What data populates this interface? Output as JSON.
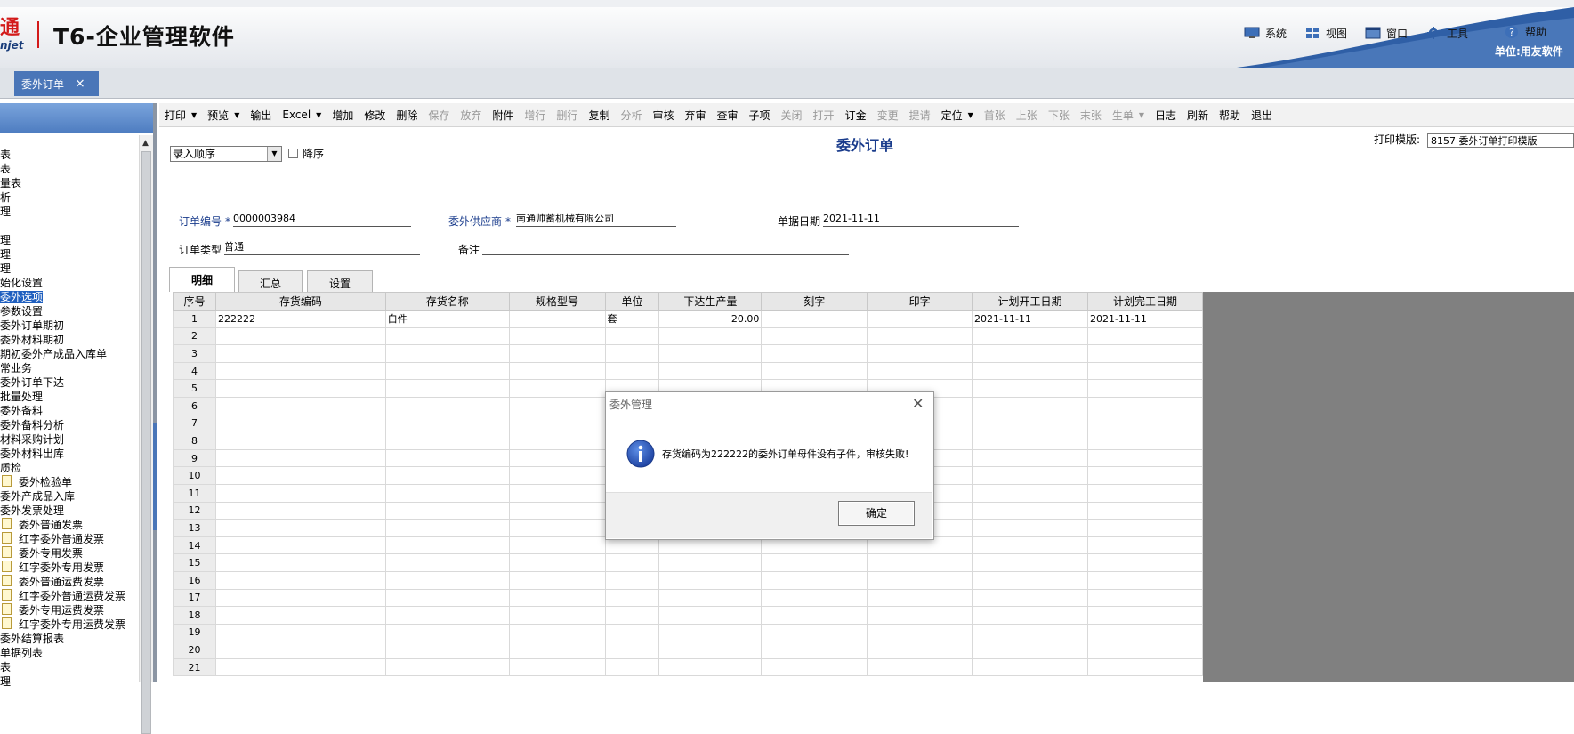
{
  "header": {
    "logo_main": "通",
    "logo_sub": "njet",
    "app_title": "T6-企业管理软件",
    "menu": [
      {
        "label": "系统",
        "icon": "monitor-icon"
      },
      {
        "label": "视图",
        "icon": "grid-icon"
      },
      {
        "label": "窗口",
        "icon": "window-icon"
      },
      {
        "label": "工具",
        "icon": "tools-icon"
      },
      {
        "label": "帮助",
        "icon": "help-icon"
      }
    ],
    "unit_label": "单位:用友软件"
  },
  "tabs": [
    {
      "label": "委外订单"
    }
  ],
  "sidebar": {
    "items": [
      {
        "label": "表"
      },
      {
        "label": "表"
      },
      {
        "label": "量表"
      },
      {
        "label": "析"
      },
      {
        "label": "理"
      },
      {
        "label": ""
      },
      {
        "label": "理"
      },
      {
        "label": "理"
      },
      {
        "label": "理"
      },
      {
        "label": "始化设置"
      },
      {
        "label": "委外选项",
        "selected": true
      },
      {
        "label": "参数设置"
      },
      {
        "label": "委外订单期初"
      },
      {
        "label": "委外材料期初"
      },
      {
        "label": "期初委外产成品入库单"
      },
      {
        "label": "常业务"
      },
      {
        "label": "委外订单下达"
      },
      {
        "label": "批量处理"
      },
      {
        "label": "委外备料"
      },
      {
        "label": "委外备料分析"
      },
      {
        "label": "材料采购计划"
      },
      {
        "label": "委外材料出库"
      },
      {
        "label": "质检"
      },
      {
        "label": "委外检验单",
        "folder": true
      },
      {
        "label": "委外产成品入库"
      },
      {
        "label": "委外发票处理"
      },
      {
        "label": "委外普通发票",
        "folder": true
      },
      {
        "label": "红字委外普通发票",
        "folder": true
      },
      {
        "label": "委外专用发票",
        "folder": true
      },
      {
        "label": "红字委外专用发票",
        "folder": true
      },
      {
        "label": "委外普通运费发票",
        "folder": true
      },
      {
        "label": "红字委外普通运费发票",
        "folder": true
      },
      {
        "label": "委外专用运费发票",
        "folder": true
      },
      {
        "label": "红字委外专用运费发票",
        "folder": true
      },
      {
        "label": "委外结算报表"
      },
      {
        "label": "单据列表"
      },
      {
        "label": "表"
      },
      {
        "label": "理"
      }
    ]
  },
  "toolbar": {
    "buttons": [
      {
        "label": "打印",
        "dropdown": true
      },
      {
        "label": "预览",
        "dropdown": true
      },
      {
        "label": "输出"
      },
      {
        "label": "Excel",
        "dropdown": true
      },
      {
        "label": "增加"
      },
      {
        "label": "修改"
      },
      {
        "label": "删除"
      },
      {
        "label": "保存",
        "disabled": true
      },
      {
        "label": "放弃",
        "disabled": true
      },
      {
        "label": "附件"
      },
      {
        "label": "增行",
        "disabled": true
      },
      {
        "label": "删行",
        "disabled": true
      },
      {
        "label": "复制"
      },
      {
        "label": "分析",
        "disabled": true
      },
      {
        "label": "审核"
      },
      {
        "label": "弃审"
      },
      {
        "label": "查审"
      },
      {
        "label": "子项"
      },
      {
        "label": "关闭",
        "disabled": true
      },
      {
        "label": "打开",
        "disabled": true
      },
      {
        "label": "订金"
      },
      {
        "label": "变更",
        "disabled": true
      },
      {
        "label": "提请",
        "disabled": true
      },
      {
        "label": "定位",
        "dropdown": true
      },
      {
        "label": "首张",
        "disabled": true
      },
      {
        "label": "上张",
        "disabled": true
      },
      {
        "label": "下张",
        "disabled": true
      },
      {
        "label": "末张",
        "disabled": true
      },
      {
        "label": "生单",
        "dropdown": true,
        "disabled": true
      },
      {
        "label": "日志"
      },
      {
        "label": "刷新"
      },
      {
        "label": "帮助"
      },
      {
        "label": "退出"
      }
    ]
  },
  "form": {
    "title": "委外订单",
    "print_template_label": "打印模版:",
    "print_template_value": "8157 委外订单打印模版",
    "sort_value": "录入顺序",
    "desc_label": "降序",
    "order_no_label": "订单编号",
    "order_no_value": "0000003984",
    "supplier_label": "委外供应商",
    "supplier_value": "南通帅蓄机械有限公司",
    "date_label": "单据日期",
    "date_value": "2021-11-11",
    "order_type_label": "订单类型",
    "order_type_value": "普通",
    "remark_label": "备注",
    "remark_value": "",
    "required_mark": "*"
  },
  "form_tabs": [
    {
      "label": "明细",
      "active": true
    },
    {
      "label": "汇总"
    },
    {
      "label": "设置"
    }
  ],
  "grid": {
    "columns": [
      "序号",
      "存货编码",
      "存货名称",
      "规格型号",
      "单位",
      "下达生产量",
      "刻字",
      "印字",
      "计划开工日期",
      "计划完工日期"
    ],
    "rows": [
      [
        "1",
        "222222",
        "白件",
        "",
        "套",
        "20.00",
        "",
        "",
        "2021-11-11",
        "2021-11-11"
      ],
      [
        "2",
        "",
        "",
        "",
        "",
        "",
        "",
        "",
        "",
        ""
      ],
      [
        "3",
        "",
        "",
        "",
        "",
        "",
        "",
        "",
        "",
        ""
      ],
      [
        "4",
        "",
        "",
        "",
        "",
        "",
        "",
        "",
        "",
        ""
      ],
      [
        "5",
        "",
        "",
        "",
        "",
        "",
        "",
        "",
        "",
        ""
      ],
      [
        "6",
        "",
        "",
        "",
        "",
        "",
        "",
        "",
        "",
        ""
      ],
      [
        "7",
        "",
        "",
        "",
        "",
        "",
        "",
        "",
        "",
        ""
      ],
      [
        "8",
        "",
        "",
        "",
        "",
        "",
        "",
        "",
        "",
        ""
      ],
      [
        "9",
        "",
        "",
        "",
        "",
        "",
        "",
        "",
        "",
        ""
      ],
      [
        "10",
        "",
        "",
        "",
        "",
        "",
        "",
        "",
        "",
        ""
      ],
      [
        "11",
        "",
        "",
        "",
        "",
        "",
        "",
        "",
        "",
        ""
      ],
      [
        "12",
        "",
        "",
        "",
        "",
        "",
        "",
        "",
        "",
        ""
      ],
      [
        "13",
        "",
        "",
        "",
        "",
        "",
        "",
        "",
        "",
        ""
      ],
      [
        "14",
        "",
        "",
        "",
        "",
        "",
        "",
        "",
        "",
        ""
      ],
      [
        "15",
        "",
        "",
        "",
        "",
        "",
        "",
        "",
        "",
        ""
      ],
      [
        "16",
        "",
        "",
        "",
        "",
        "",
        "",
        "",
        "",
        ""
      ],
      [
        "17",
        "",
        "",
        "",
        "",
        "",
        "",
        "",
        "",
        ""
      ],
      [
        "18",
        "",
        "",
        "",
        "",
        "",
        "",
        "",
        "",
        ""
      ],
      [
        "19",
        "",
        "",
        "",
        "",
        "",
        "",
        "",
        "",
        ""
      ],
      [
        "20",
        "",
        "",
        "",
        "",
        "",
        "",
        "",
        "",
        ""
      ],
      [
        "21",
        "",
        "",
        "",
        "",
        "",
        "",
        "",
        "",
        ""
      ]
    ]
  },
  "dialog": {
    "title": "委外管理",
    "message": "存货编码为222222的委外订单母件没有子件，审核失败!",
    "ok_label": "确定",
    "icon": "info-icon"
  },
  "colors": {
    "accent": "#4a76b8",
    "selected": "#1f5fbf",
    "title_blue": "#1a3c8c",
    "brand_red": "#d31a1a"
  }
}
